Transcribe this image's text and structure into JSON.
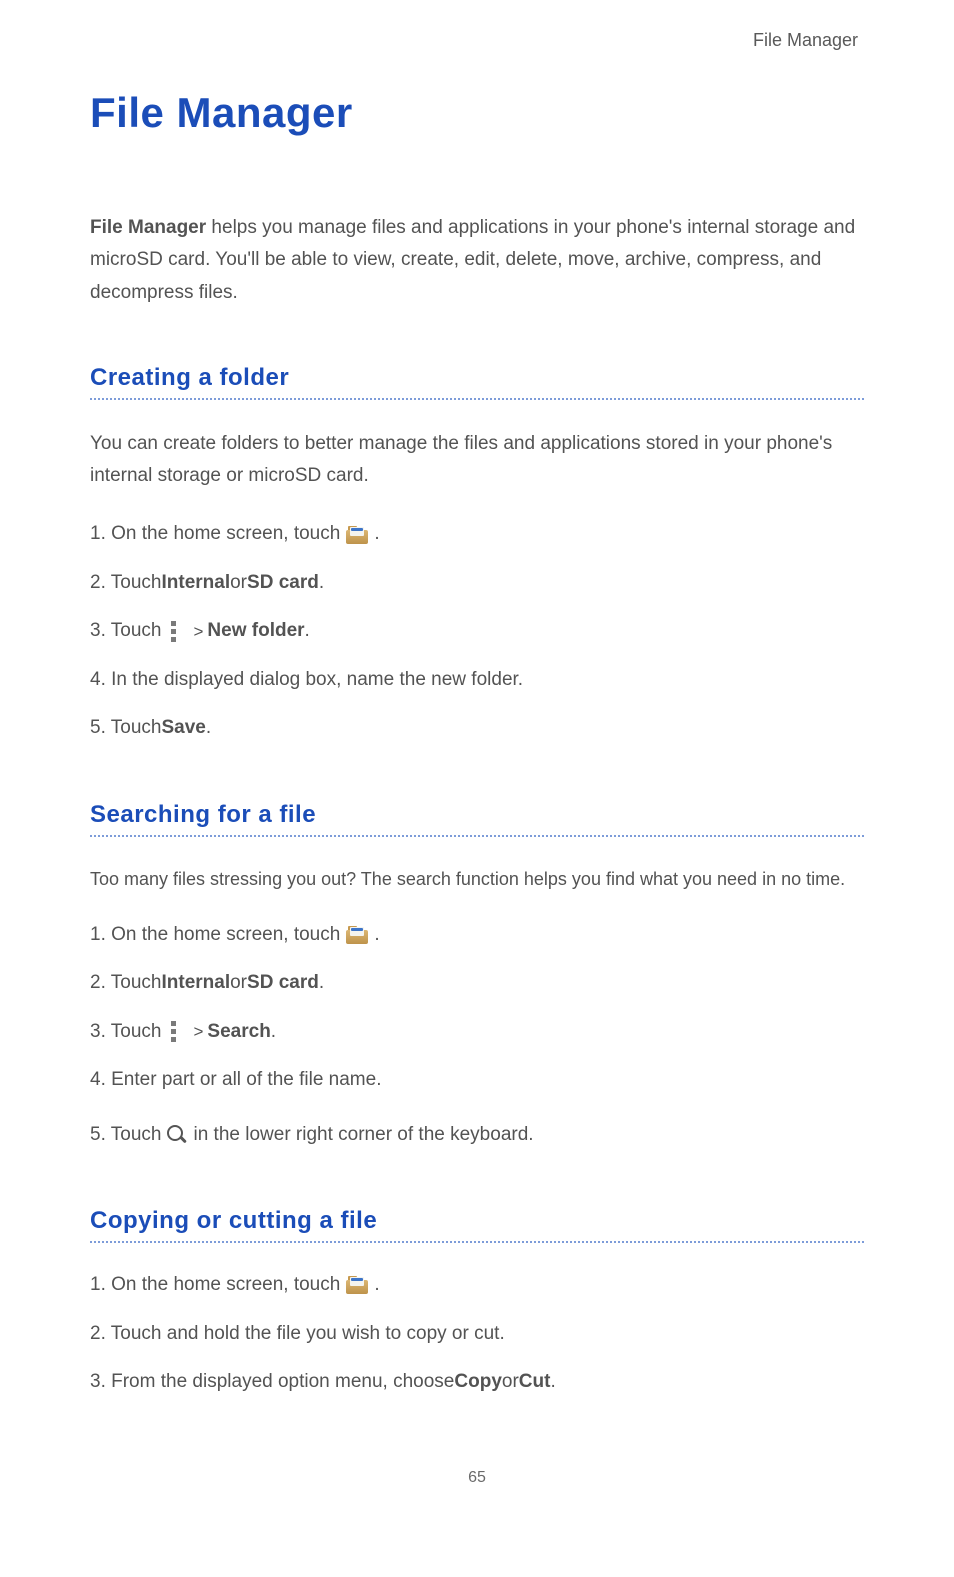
{
  "header": {
    "running_head": "File Manager"
  },
  "title": "File Manager",
  "intro": {
    "lead_bold": "File Manager",
    "rest": " helps you manage files and applications in your phone's internal storage and microSD card. You'll be able to view, create, edit, delete, move, archive, compress, and decompress files."
  },
  "sections": {
    "creating_folder": {
      "heading": "Creating a folder",
      "intro": "You can create folders to better manage the files and applications stored in your phone's internal storage or microSD card.",
      "steps": {
        "s1_prefix": "1. On the home screen, touch ",
        "s1_suffix": ".",
        "s2_prefix": "2. Touch ",
        "s2_b1": "Internal",
        "s2_mid": " or ",
        "s2_b2": "SD card",
        "s2_suffix": ".",
        "s3_prefix": "3. Touch ",
        "s3_gt": ">",
        "s3_b": " New folder",
        "s3_suffix": ".",
        "s4": "4. In the displayed dialog box, name the new folder.",
        "s5_prefix": "5. Touch ",
        "s5_b": "Save",
        "s5_suffix": "."
      }
    },
    "searching_file": {
      "heading": "Searching for a file",
      "intro": "Too many files stressing you out? The search function helps you find what you need in no time.",
      "steps": {
        "s1_prefix": "1. On the home screen, touch ",
        "s1_suffix": ".",
        "s2_prefix": "2. Touch ",
        "s2_b1": "Internal",
        "s2_mid": " or ",
        "s2_b2": "SD card",
        "s2_suffix": ".",
        "s3_prefix": "3. Touch ",
        "s3_gt": ">",
        "s3_b": " Search",
        "s3_suffix": ".",
        "s4": "4. Enter part or all of the file name.",
        "s5_prefix": "5. Touch ",
        "s5_suffix": " in the lower right corner of the keyboard."
      }
    },
    "copying_cutting": {
      "heading": "Copying or cutting a file",
      "steps": {
        "s1_prefix": "1. On the home screen, touch ",
        "s1_suffix": ".",
        "s2": "2. Touch and hold the file you wish to copy or cut.",
        "s3_prefix": "3. From the displayed option menu, choose ",
        "s3_b1": "Copy",
        "s3_mid": " or ",
        "s3_b2": "Cut",
        "s3_suffix": "."
      }
    }
  },
  "footer": {
    "page_number": "65"
  }
}
